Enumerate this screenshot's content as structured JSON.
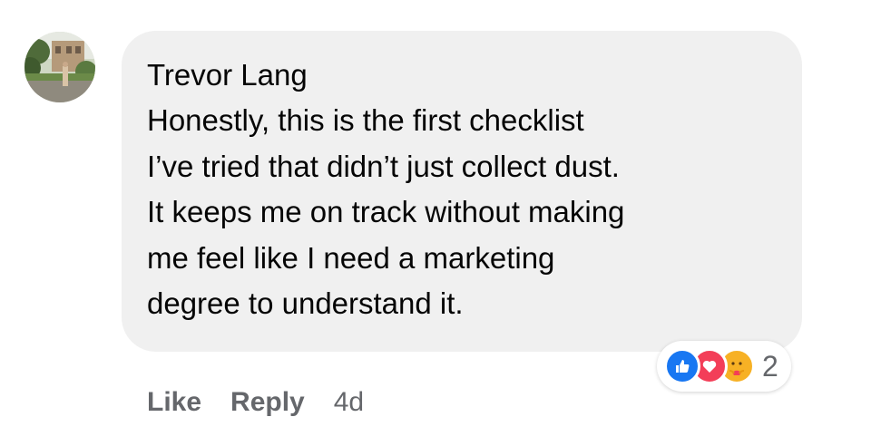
{
  "comment": {
    "author": "Trevor Lang",
    "body_lines": [
      "Honestly, this is the first checklist",
      "I’ve tried that didn’t just collect dust.",
      "It keeps me on track without making",
      "me feel like I need a marketing",
      "degree to understand it."
    ],
    "reactions": {
      "icons": [
        "like-icon",
        "love-icon",
        "care-icon"
      ],
      "count": "2"
    },
    "actions": {
      "like_label": "Like",
      "reply_label": "Reply",
      "time": "4d"
    }
  },
  "colors": {
    "bubble": "#f0f0f0",
    "text": "#050505",
    "secondary_text": "#65676b",
    "like_blue": "#1877f2",
    "love_red": "#f33e58",
    "care_yellow": "#f7b125"
  }
}
